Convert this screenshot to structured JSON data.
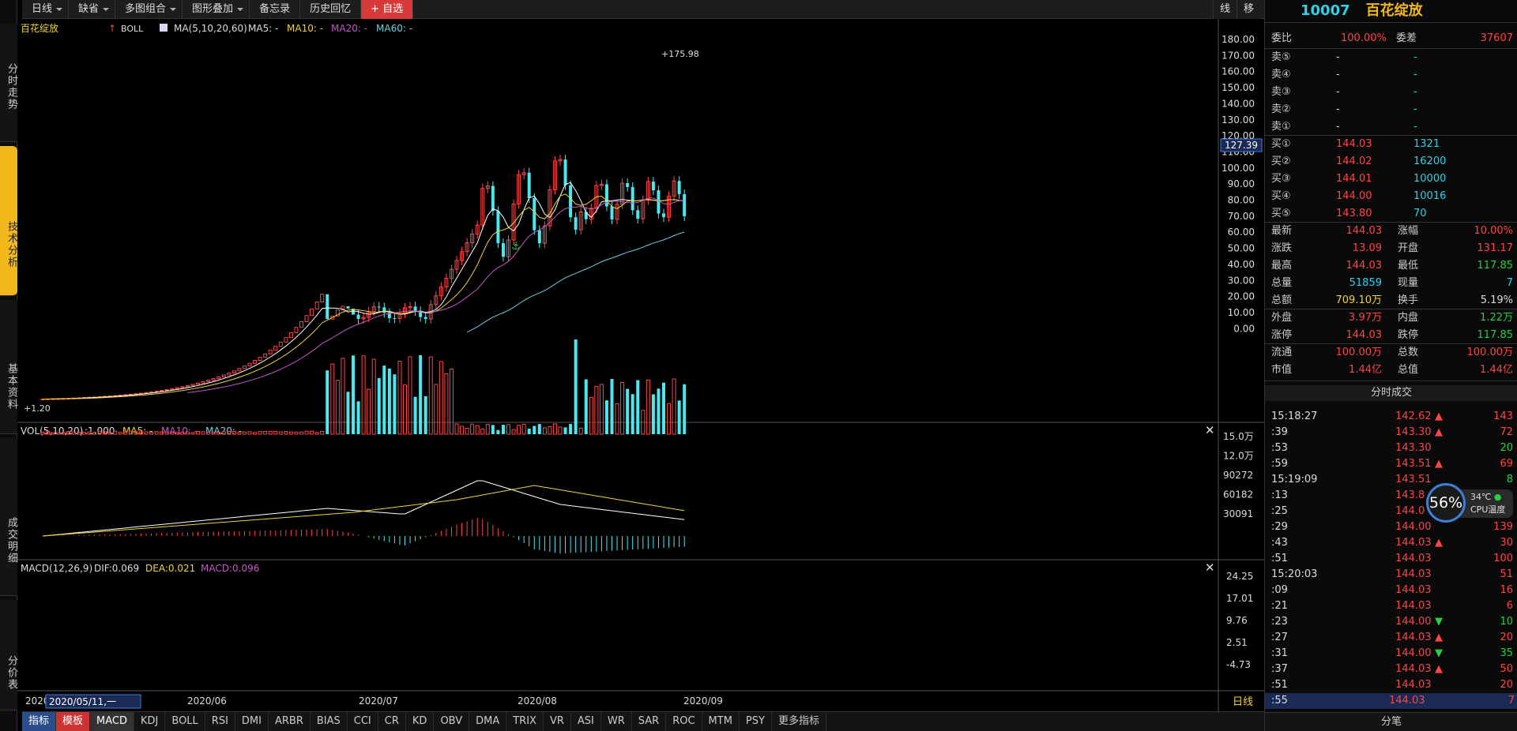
{
  "toolbar": {
    "items": [
      "日线",
      "缺省",
      "多图组合",
      "图形叠加",
      "备忘录",
      "历史回忆",
      "+ 自选"
    ],
    "right": [
      "线",
      "移"
    ]
  },
  "left_tabs": [
    "分时走势",
    "技术分析",
    "基本资料",
    "成交明细",
    "分价表"
  ],
  "main_chart": {
    "stock_name": "百花绽放",
    "boll_label": "BOLL",
    "ma_label": "MA(5,10,20,60)",
    "ma5": "MA5: -",
    "ma10": "MA10: -",
    "ma20": "MA20: -",
    "ma60": "MA60: -",
    "high_mark": "175.98",
    "low_mark": "1.20",
    "current_price_tag": "127.39",
    "yaxis_labels": [
      "180.00",
      "170.00",
      "160.00",
      "150.00",
      "140.00",
      "130.00",
      "120.00",
      "110.00",
      "100.00",
      "90.00",
      "80.00",
      "70.00",
      "60.00",
      "50.00",
      "40.00",
      "30.00",
      "20.00",
      "10.00",
      "0.00"
    ]
  },
  "vol_panel": {
    "label": "VOL(5,10,20)",
    "ratio": ":1.000",
    "ma5": "MA5: -",
    "ma10": "MA10: -",
    "ma20": "MA20: -",
    "yaxis_labels": [
      "15.0万",
      "12.0万",
      "90272",
      "60182",
      "30091"
    ],
    "close": "✕"
  },
  "macd_panel": {
    "label": "MACD(12,26,9)",
    "dif": "DIF:0.069",
    "dea": "DEA:0.021",
    "macd": "MACD:0.096",
    "yaxis_labels": [
      "24.25",
      "17.01",
      "9.76",
      "2.51",
      "-4.73"
    ],
    "close": "✕"
  },
  "xaxis": {
    "labels": [
      "2020",
      "2020/06",
      "2020/07",
      "2020/08",
      "2020/09"
    ],
    "cursor_date": "2020/05/11,一",
    "period": "日线"
  },
  "bottom_tabs": [
    "指标",
    "模板",
    "MACD",
    "KDJ",
    "BOLL",
    "RSI",
    "DMI",
    "ARBR",
    "BIAS",
    "CCI",
    "CR",
    "KD",
    "OBV",
    "DMA",
    "TRIX",
    "VR",
    "ASI",
    "WR",
    "SAR",
    "ROC",
    "MTM",
    "PSY",
    "更多指标"
  ],
  "quote": {
    "code": "10007",
    "name": "百花绽放",
    "weibi_label": "委比",
    "weibi": "100.00%",
    "weicha_label": "委差",
    "weicha": "37607",
    "sells": [
      {
        "label": "卖⑤",
        "price": "-",
        "vol": "-"
      },
      {
        "label": "卖④",
        "price": "-",
        "vol": "-"
      },
      {
        "label": "卖③",
        "price": "-",
        "vol": "-"
      },
      {
        "label": "卖②",
        "price": "-",
        "vol": "-"
      },
      {
        "label": "卖①",
        "price": "-",
        "vol": "-"
      }
    ],
    "buys": [
      {
        "label": "买①",
        "price": "144.03",
        "vol": "1321"
      },
      {
        "label": "买②",
        "price": "144.02",
        "vol": "16200"
      },
      {
        "label": "买③",
        "price": "144.01",
        "vol": "10000"
      },
      {
        "label": "买④",
        "price": "144.00",
        "vol": "10016"
      },
      {
        "label": "买⑤",
        "price": "143.80",
        "vol": "70"
      }
    ],
    "stats": [
      {
        "l1": "最新",
        "v1": "144.03",
        "c1": "red",
        "l2": "涨幅",
        "v2": "10.00%",
        "c2": "red"
      },
      {
        "l1": "涨跌",
        "v1": "13.09",
        "c1": "red",
        "l2": "开盘",
        "v2": "131.17",
        "c2": "red"
      },
      {
        "l1": "最高",
        "v1": "144.03",
        "c1": "red",
        "l2": "最低",
        "v2": "117.85",
        "c2": "green"
      },
      {
        "l1": "总量",
        "v1": "51859",
        "c1": "cyan",
        "l2": "现量",
        "v2": "7",
        "c2": "cyan"
      },
      {
        "l1": "总额",
        "v1": "709.10万",
        "c1": "yellow",
        "l2": "换手",
        "v2": "5.19%",
        "c2": "white"
      }
    ],
    "stats2": [
      {
        "l1": "外盘",
        "v1": "3.97万",
        "c1": "red",
        "l2": "内盘",
        "v2": "1.22万",
        "c2": "green"
      },
      {
        "l1": "涨停",
        "v1": "144.03",
        "c1": "red",
        "l2": "跌停",
        "v2": "117.85",
        "c2": "green"
      }
    ],
    "stats3": [
      {
        "l1": "流通",
        "v1": "100.00万",
        "c1": "red",
        "l2": "总数",
        "v2": "100.00万",
        "c2": "red"
      },
      {
        "l1": "市值",
        "v1": "1.44亿",
        "c1": "red",
        "l2": "总值",
        "v2": "1.44亿",
        "c2": "red"
      }
    ],
    "trades_title": "分时成交",
    "trades": [
      {
        "t": "15:18:27",
        "p": "142.62",
        "a": "▲",
        "v": "143",
        "pc": "red",
        "vc": "red"
      },
      {
        "t": ":39",
        "p": "143.30",
        "a": "▲",
        "v": "72",
        "pc": "red",
        "vc": "red"
      },
      {
        "t": ":53",
        "p": "143.30",
        "a": "",
        "v": "20",
        "pc": "red",
        "vc": "green"
      },
      {
        "t": ":59",
        "p": "143.51",
        "a": "▲",
        "v": "69",
        "pc": "red",
        "vc": "red"
      },
      {
        "t": "15:19:09",
        "p": "143.51",
        "a": "",
        "v": "8",
        "pc": "red",
        "vc": "green"
      },
      {
        "t": ":13",
        "p": "143.8",
        "a": "",
        "v": "",
        "pc": "red",
        "vc": "red"
      },
      {
        "t": ":25",
        "p": "144.0",
        "a": "",
        "v": "",
        "pc": "red",
        "vc": "red"
      },
      {
        "t": ":29",
        "p": "144.00",
        "a": "",
        "v": "139",
        "pc": "red",
        "vc": "red"
      },
      {
        "t": ":43",
        "p": "144.03",
        "a": "▲",
        "v": "30",
        "pc": "red",
        "vc": "red"
      },
      {
        "t": ":51",
        "p": "144.03",
        "a": "",
        "v": "100",
        "pc": "red",
        "vc": "red"
      },
      {
        "t": "15:20:03",
        "p": "144.03",
        "a": "",
        "v": "51",
        "pc": "red",
        "vc": "red"
      },
      {
        "t": ":09",
        "p": "144.03",
        "a": "",
        "v": "16",
        "pc": "red",
        "vc": "red"
      },
      {
        "t": ":21",
        "p": "144.03",
        "a": "",
        "v": "6",
        "pc": "red",
        "vc": "red"
      },
      {
        "t": ":23",
        "p": "144.00",
        "a": "▼",
        "v": "10",
        "pc": "red",
        "vc": "green"
      },
      {
        "t": ":27",
        "p": "144.03",
        "a": "▲",
        "v": "20",
        "pc": "red",
        "vc": "red"
      },
      {
        "t": ":31",
        "p": "144.00",
        "a": "▼",
        "v": "35",
        "pc": "red",
        "vc": "green"
      },
      {
        "t": ":37",
        "p": "144.03",
        "a": "▲",
        "v": "50",
        "pc": "red",
        "vc": "red"
      },
      {
        "t": ":51",
        "p": "144.03",
        "a": "",
        "v": "20",
        "pc": "red",
        "vc": "red"
      },
      {
        "t": ":55",
        "p": "144.03",
        "a": "",
        "v": "7",
        "pc": "red",
        "vc": "red"
      }
    ],
    "footer": "分笔"
  },
  "cpu": {
    "percent": "56%",
    "temp": "34℃",
    "label": "CPU温度"
  }
}
